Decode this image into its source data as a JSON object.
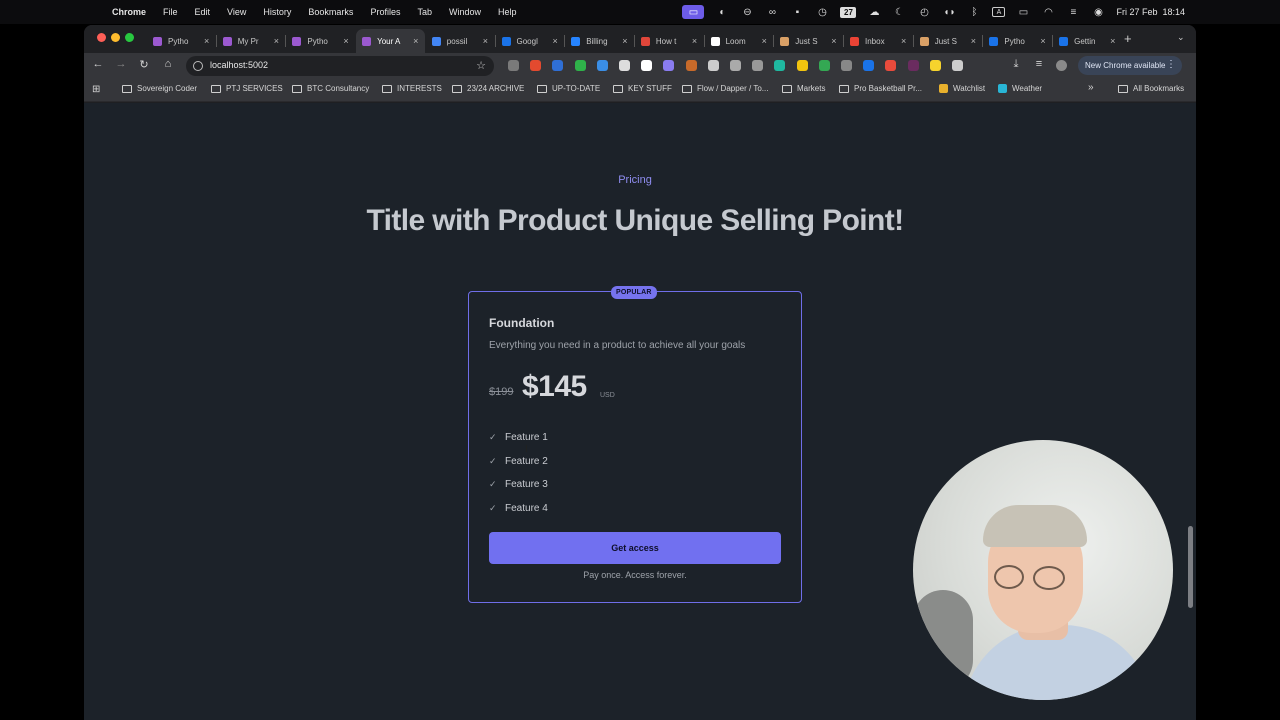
{
  "menubar": {
    "app": "Chrome",
    "items": [
      "File",
      "Edit",
      "View",
      "History",
      "Bookmarks",
      "Profiles",
      "Tab",
      "Window",
      "Help"
    ],
    "calendar_day": "27",
    "datetime": "Fri 27 Feb  18:14"
  },
  "tabs": [
    {
      "label": "Pytho",
      "color": "#9b59d0"
    },
    {
      "label": "My Pr",
      "color": "#9b59d0"
    },
    {
      "label": "Pytho",
      "color": "#9b59d0"
    },
    {
      "label": "Your A",
      "color": "#9b59d0",
      "active": true
    },
    {
      "label": "possil",
      "color": "#4285f4"
    },
    {
      "label": "Googl",
      "color": "#1a73e8"
    },
    {
      "label": "Billing",
      "color": "#2684ff"
    },
    {
      "label": "How t",
      "color": "#e0463a"
    },
    {
      "label": "Loom",
      "color": "#ffffff"
    },
    {
      "label": "Just S",
      "color": "#d9a066"
    },
    {
      "label": "Inbox",
      "color": "#ea4335"
    },
    {
      "label": "Just S",
      "color": "#d9a066"
    },
    {
      "label": "Pytho",
      "color": "#1a73e8"
    },
    {
      "label": "Gettin",
      "color": "#1a73e8"
    }
  ],
  "address": {
    "url": "localhost:5002"
  },
  "update_button": "New Chrome available",
  "bookmarks": [
    {
      "label": "Sovereign Coder",
      "type": "folder"
    },
    {
      "label": "PTJ SERVICES",
      "type": "folder"
    },
    {
      "label": "BTC Consultancy",
      "type": "folder"
    },
    {
      "label": "INTERESTS",
      "type": "folder"
    },
    {
      "label": "23/24 ARCHIVE",
      "type": "folder"
    },
    {
      "label": "UP-TO-DATE",
      "type": "folder"
    },
    {
      "label": "KEY STUFF",
      "type": "folder"
    },
    {
      "label": "Flow / Dapper / To...",
      "type": "folder"
    },
    {
      "label": "Markets",
      "type": "folder"
    },
    {
      "label": "Pro Basketball Pr...",
      "type": "folder"
    },
    {
      "label": "Watchlist",
      "type": "link"
    },
    {
      "label": "Weather",
      "type": "link"
    }
  ],
  "bookmarks_overflow": "»",
  "all_bookmarks": "All Bookmarks",
  "page": {
    "eyebrow": "Pricing",
    "headline": "Title with Product Unique Selling Point!",
    "card": {
      "badge": "POPULAR",
      "name": "Foundation",
      "description": "Everything you need in a product to achieve all your goals",
      "old_price": "$199",
      "price": "$145",
      "currency": "USD",
      "features": [
        "Feature 1",
        "Feature 2",
        "Feature 3",
        "Feature 4"
      ],
      "cta": "Get access",
      "note": "Pay once. Access forever."
    }
  },
  "colors": {
    "accent": "#7170f0",
    "page_bg": "#1c2229",
    "headline": "#c5c9cf"
  }
}
